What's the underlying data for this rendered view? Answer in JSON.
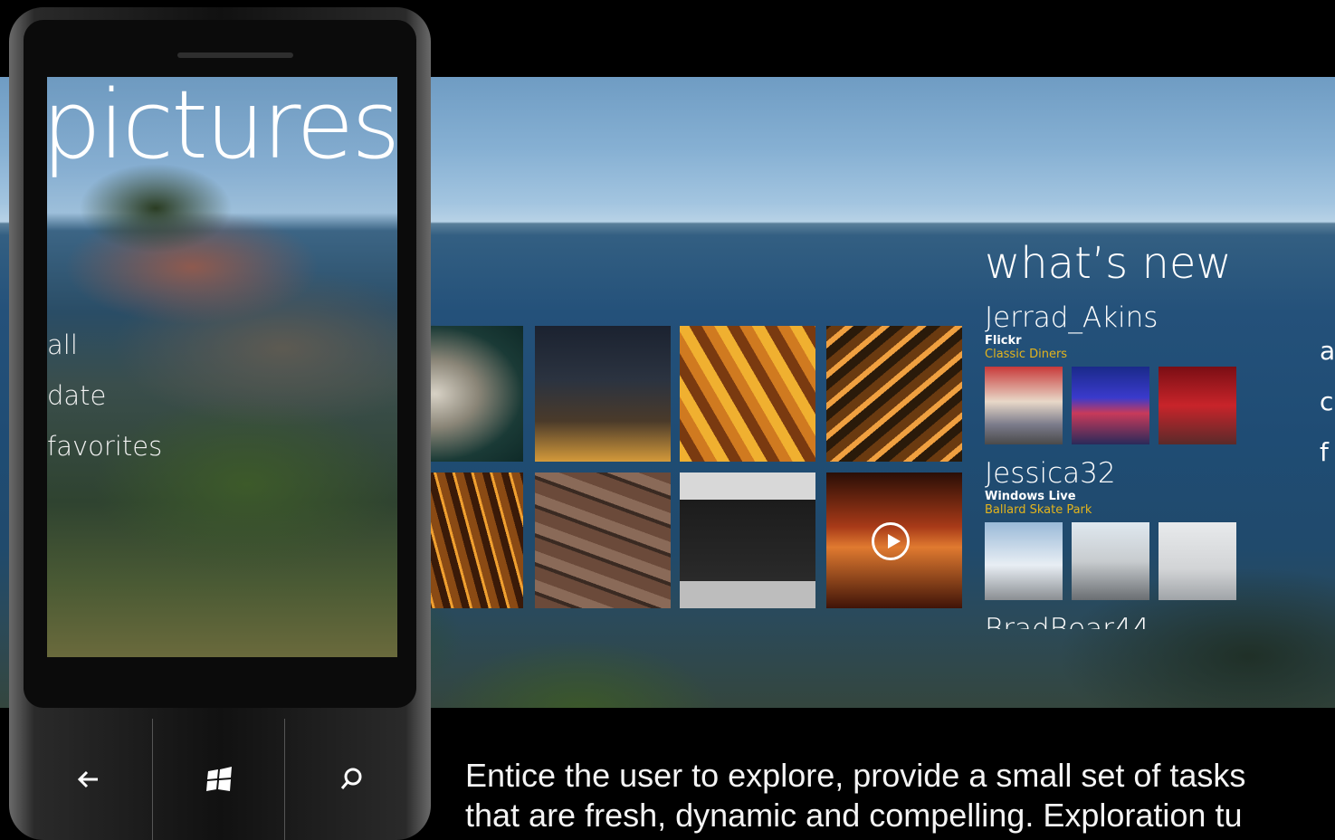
{
  "panorama": {
    "title": "pictures",
    "whats_new": {
      "heading": "what’s new",
      "feeds": [
        {
          "user": "Jerrad_Akins",
          "service": "Flickr",
          "album": "Classic Diners"
        },
        {
          "user": "Jessica32",
          "service": "Windows Live",
          "album": "Ballard Skate Park"
        }
      ],
      "partial_user": "BradBear44"
    },
    "next_pane_items": [
      "a",
      "c",
      "f"
    ]
  },
  "phone": {
    "title": "pictures",
    "menu": [
      "all",
      "date",
      "favorites"
    ],
    "buttons": [
      {
        "name": "back-icon"
      },
      {
        "name": "windows-start-icon"
      },
      {
        "name": "search-icon"
      }
    ]
  },
  "caption": {
    "line1": "Entice the user to explore, provide a small set of tasks",
    "line2": "that are fresh, dynamic and compelling. Exploration tu"
  },
  "colors": {
    "accent": "#e3b41d",
    "background": "#000000"
  }
}
